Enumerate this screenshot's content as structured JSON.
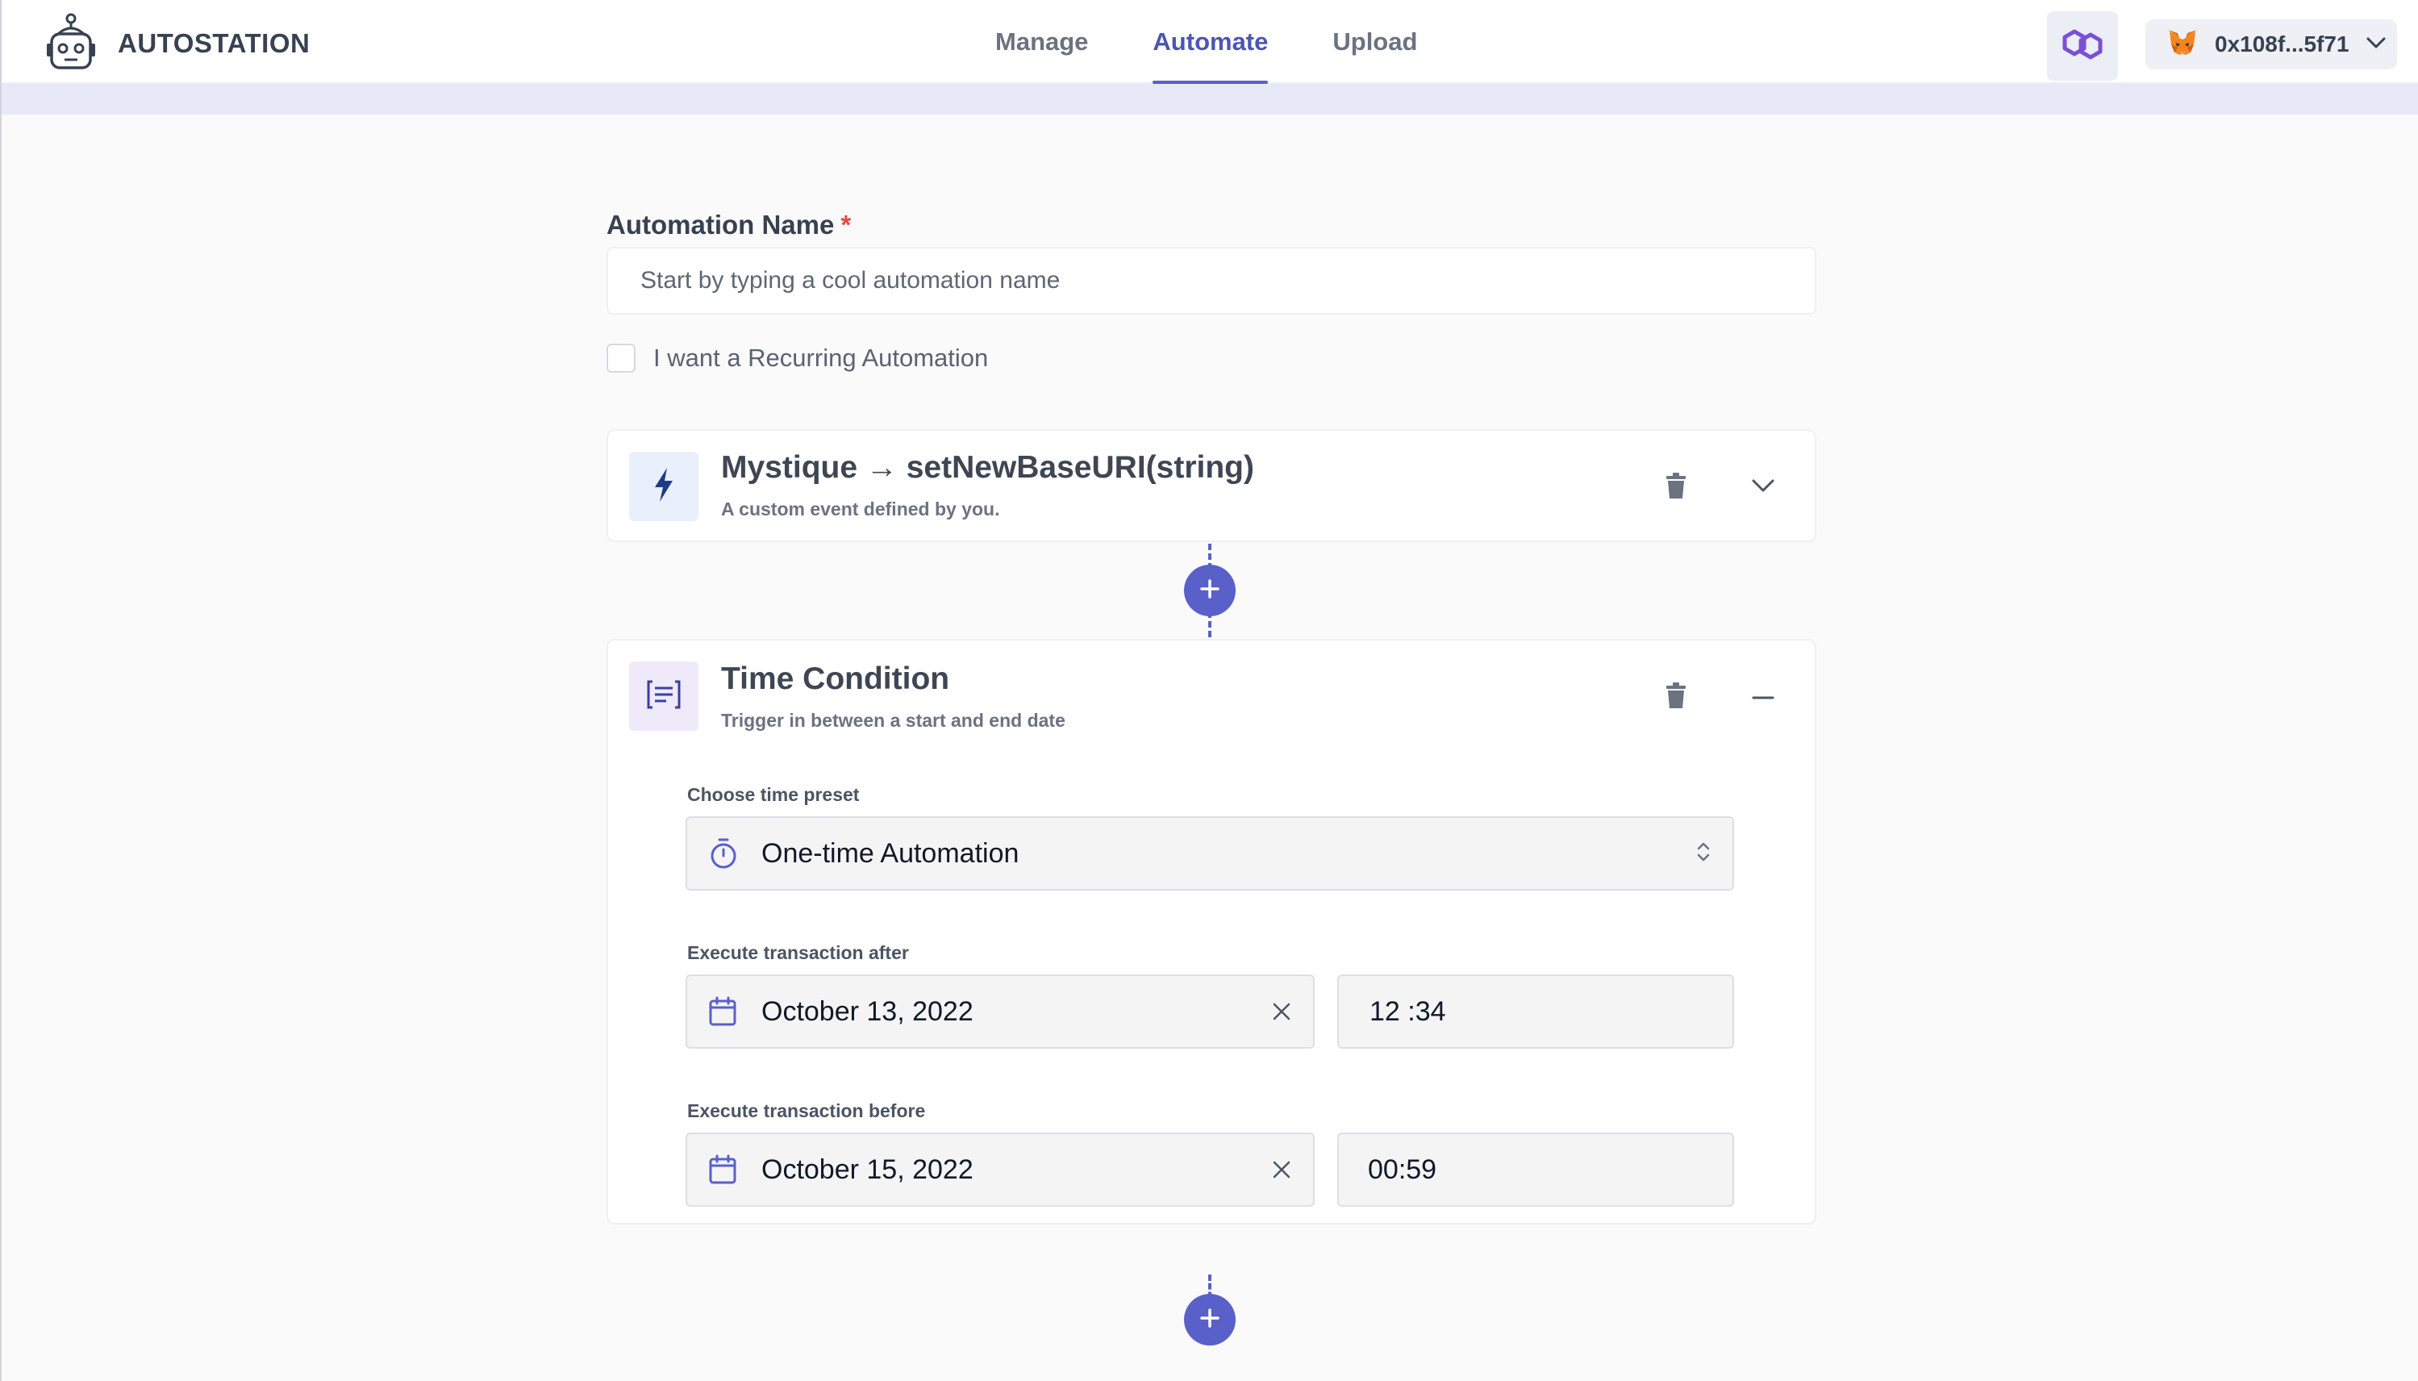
{
  "header": {
    "brand_name": "AUTOSTATION",
    "tabs": [
      {
        "label": "Manage",
        "active": false
      },
      {
        "label": "Automate",
        "active": true
      },
      {
        "label": "Upload",
        "active": false
      }
    ],
    "network_icon": "polygon-icon",
    "wallet": {
      "address": "0x108f...5f71",
      "icon": "metamask-fox-icon"
    }
  },
  "form": {
    "name_label": "Automation Name",
    "required_marker": "*",
    "name_placeholder": "Start by typing a cool automation name",
    "name_value": "",
    "recurring_label": "I want a Recurring Automation",
    "recurring_checked": false
  },
  "trigger_card": {
    "title": "Mystique → setNewBaseURI(string)",
    "subtitle": "A custom event defined by you.",
    "icon": "lightning-icon"
  },
  "time_card": {
    "title": "Time Condition",
    "subtitle": "Trigger in between a start and end date",
    "icon": "list-icon",
    "preset_label": "Choose time preset",
    "preset_value": "One-time Automation",
    "after_label": "Execute transaction after",
    "after_date": "October 13, 2022",
    "after_time": "12 :34",
    "before_label": "Execute transaction before",
    "before_date": "October 15, 2022",
    "before_time": "00:59"
  },
  "colors": {
    "accent": "#5a60c9",
    "required": "#e14b45",
    "trigger_icon_bg": "#eaf0fb",
    "condition_icon_bg": "#efeaf9"
  }
}
